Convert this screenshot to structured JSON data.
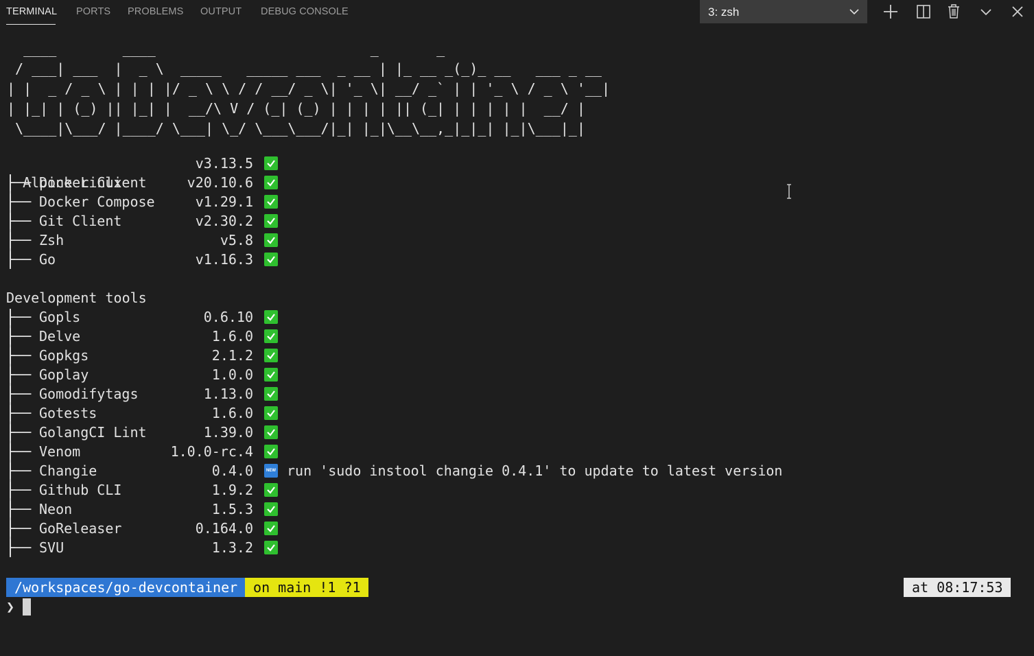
{
  "tabs": [
    {
      "label": "TERMINAL",
      "active": true
    },
    {
      "label": "PORTS",
      "active": false
    },
    {
      "label": "PROBLEMS",
      "active": false
    },
    {
      "label": "OUTPUT",
      "active": false
    },
    {
      "label": "DEBUG CONSOLE",
      "active": false
    }
  ],
  "terminal_selector": {
    "selected": "3: zsh"
  },
  "actions": [
    {
      "icon": "plus-icon"
    },
    {
      "icon": "split-icon"
    },
    {
      "icon": "trash-icon"
    },
    {
      "icon": "chevron-down-icon"
    },
    {
      "icon": "close-icon"
    }
  ],
  "banner": "  ____        ____                          _       _\n / ___| ___  |  _ \\  _____   _____ ___  _ __ | |_ __ _(_)_ __   ___ _ __\n| |  _ / _ \\ | | | |/ _ \\ \\ / / __/ _ \\| '_ \\| __/ _` | | '_ \\ / _ \\ '__|\n| |_| | (_) || |_| |  __/\\ V / (_| (_) | | | | || (_| | | | | |  __/ |\n \\____|\\___/ |____/ \\___| \\_/ \\___\\___/|_| |_|\\__\\__,_|_|_| |_|\\___|_|",
  "os": {
    "name": "Alpine Linux",
    "version": "v3.13.5",
    "status": "check"
  },
  "base_tools": [
    {
      "name": "Docker Client",
      "version": "v20.10.6",
      "status": "check"
    },
    {
      "name": "Docker Compose",
      "version": "v1.29.1",
      "status": "check"
    },
    {
      "name": "Git Client",
      "version": "v2.30.2",
      "status": "check"
    },
    {
      "name": "Zsh",
      "version": "v5.8",
      "status": "check"
    },
    {
      "name": "Go",
      "version": "v1.16.3",
      "status": "check"
    }
  ],
  "dev_section_title": "Development tools",
  "dev_tools": [
    {
      "name": "Gopls",
      "version": "0.6.10",
      "status": "check"
    },
    {
      "name": "Delve",
      "version": "1.6.0",
      "status": "check"
    },
    {
      "name": "Gopkgs",
      "version": "2.1.2",
      "status": "check"
    },
    {
      "name": "Goplay",
      "version": "1.0.0",
      "status": "check"
    },
    {
      "name": "Gomodifytags",
      "version": "1.13.0",
      "status": "check"
    },
    {
      "name": "Gotests",
      "version": "1.6.0",
      "status": "check"
    },
    {
      "name": "GolangCI Lint",
      "version": "1.39.0",
      "status": "check"
    },
    {
      "name": "Venom",
      "version": "1.0.0-rc.4",
      "status": "check"
    },
    {
      "name": "Changie",
      "version": "0.4.0",
      "status": "new",
      "badge": "NEW",
      "hint": "run 'sudo instool changie 0.4.1' to update to latest version"
    },
    {
      "name": "Github CLI",
      "version": "1.9.2",
      "status": "check"
    },
    {
      "name": "Neon",
      "version": "1.5.3",
      "status": "check"
    },
    {
      "name": "GoReleaser",
      "version": "0.164.0",
      "status": "check"
    },
    {
      "name": "SVU",
      "version": "1.3.2",
      "status": "check"
    }
  ],
  "tree_branch": "├──",
  "prompt": {
    "path": " /workspaces/go-devcontainer ",
    "git": " on main !1 ?1 ",
    "time": " at 08:17:53 ",
    "symbol": "❯"
  },
  "colors": {
    "background": "#1e1e1e",
    "check_green": "#2fbf2f",
    "path_blue": "#2f77d3",
    "git_yellow": "#e5e510"
  }
}
